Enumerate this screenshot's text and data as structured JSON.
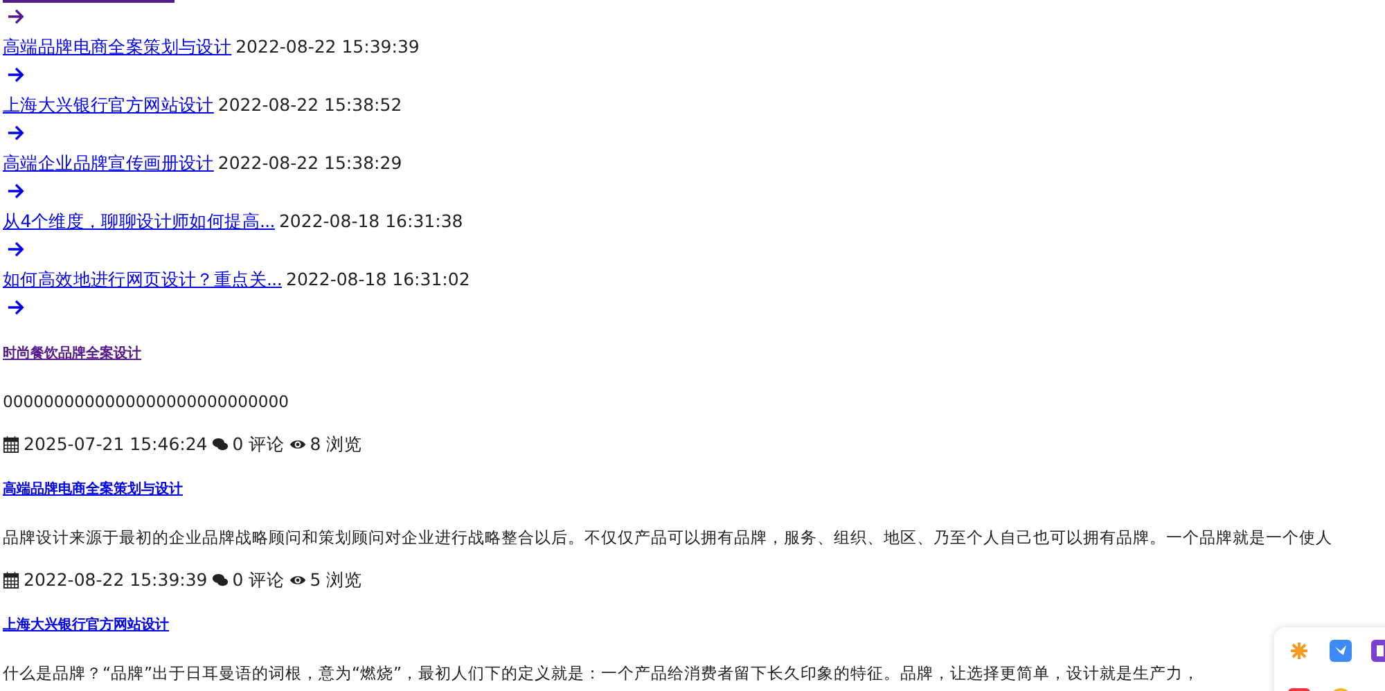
{
  "top_item": {
    "visited": true
  },
  "recent": [
    {
      "title": "高端品牌电商全案策划与设计",
      "date": "2022-08-22 15:39:39",
      "visited": false
    },
    {
      "title": "上海大兴银行官方网站设计",
      "date": "2022-08-22 15:38:52",
      "visited": false
    },
    {
      "title": "高端企业品牌宣传画册设计",
      "date": "2022-08-22 15:38:29",
      "visited": false
    },
    {
      "title": "从4个维度，聊聊设计师如何提高...",
      "date": "2022-08-18 16:31:38",
      "visited": false
    },
    {
      "title": "如何高效地进行网页设计？重点关...",
      "date": "2022-08-18 16:31:02",
      "visited": false
    }
  ],
  "articles": [
    {
      "title": "时尚餐饮品牌全案设计",
      "visited": true,
      "excerpt": "0000000000000000000000000000",
      "date": "2025-07-21 15:46:24",
      "comments": "0 评论",
      "views": "8 浏览"
    },
    {
      "title": "高端品牌电商全案策划与设计",
      "visited": false,
      "excerpt": "品牌设计来源于最初的企业品牌战略顾问和策划顾问对企业进行战略整合以后。不仅仅产品可以拥有品牌，服务、组织、地区、乃至个人自己也可以拥有品牌。一个品牌就是一个使人",
      "date": "2022-08-22 15:39:39",
      "comments": "0 评论",
      "views": "5 浏览"
    },
    {
      "title": "上海大兴银行官方网站设计",
      "visited": false,
      "excerpt": "什么是品牌？“品牌”出于日耳曼语的词根，意为“燃烧”，最初人们下的定义就是：一个产品给消费者留下长久印象的特征。品牌，让选择更简单，设计就是生产力，"
    }
  ]
}
